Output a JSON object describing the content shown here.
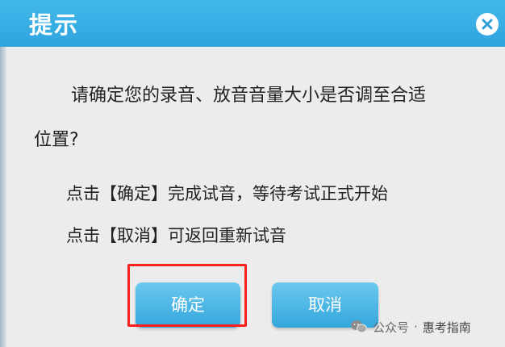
{
  "dialog": {
    "title": "提示",
    "message_line1": "请确定您的录音、放音音量大小是否调至合适",
    "message_line2": "位置?",
    "instruction_confirm": "点击【确定】完成试音，等待考试正式开始",
    "instruction_cancel": "点击【取消】可返回重新试音",
    "buttons": {
      "confirm_label": "确定",
      "cancel_label": "取消"
    }
  },
  "watermark": {
    "platform": "公众号",
    "separator": "·",
    "account": "惠考指南"
  },
  "colors": {
    "titlebar": "#36aee4",
    "button": "#44b3e3",
    "highlight": "#ff1d1d",
    "dialog_background": "#ececec"
  },
  "icons": {
    "close": "close-icon",
    "watermark": "wechat-icon"
  }
}
